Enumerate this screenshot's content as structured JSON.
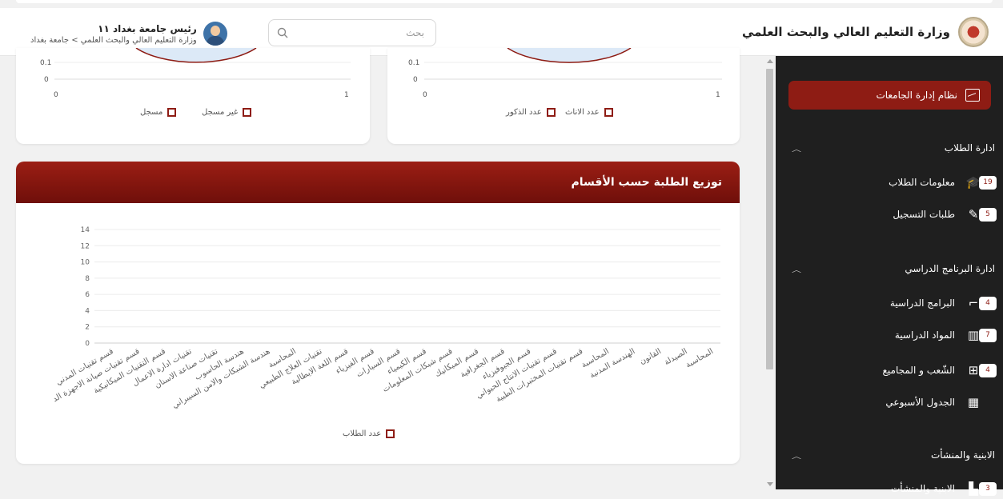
{
  "header": {
    "brand_title": "وزارة التعليم العالي والبحث العلمي",
    "search_placeholder": "بحث",
    "user_name": "رئيس جامعة بغداد ١١",
    "user_breadcrumb": "وزارة التعليم العالي والبحث العلمي > جامعة بغداد"
  },
  "sidebar": {
    "active_item": "نظام إدارة الجامعات",
    "sections": [
      {
        "title": "ادارة الطلاب",
        "items": [
          {
            "label": "معلومات الطلاب",
            "badge": "19",
            "icon": "graduate-icon"
          },
          {
            "label": "طلبات التسجيل",
            "badge": "5",
            "icon": "edit-icon"
          }
        ]
      },
      {
        "title": "ادارة البرنامج الدراسي",
        "items": [
          {
            "label": "البرامج الدراسية",
            "badge": "4",
            "icon": "presentation-icon"
          },
          {
            "label": "المواد الدراسية",
            "badge": "7",
            "icon": "books-icon"
          },
          {
            "label": "الشّعب و المجاميع",
            "badge": "4",
            "icon": "hierarchy-icon"
          },
          {
            "label": "الجدول الأسبوعي",
            "badge": "",
            "icon": "calendar-icon"
          }
        ]
      },
      {
        "title": "الابنية والمنشأت",
        "items": [
          {
            "label": "الابنية والمنشأت",
            "badge": "3",
            "icon": "building-icon"
          }
        ]
      }
    ]
  },
  "top_left_chart": {
    "y_ticks": [
      "0.1",
      "0"
    ],
    "x_ticks": [
      "0",
      "1"
    ],
    "legend": [
      "غير مسجل",
      "مسجل"
    ]
  },
  "top_right_chart": {
    "y_ticks": [
      "0.1",
      "0"
    ],
    "x_ticks": [
      "0",
      "1"
    ],
    "legend": [
      "عدد الاناث",
      "عدد الذكور"
    ]
  },
  "dept_card": {
    "title": "توزيع الطلبة حسب الأقسام",
    "legend": "عدد الطلاب"
  },
  "colors": {
    "accent": "#8e1c14",
    "sidebar": "#1f1f1f"
  },
  "chart_data": {
    "type": "bar",
    "title": "توزيع الطلبة حسب الأقسام",
    "ylim": [
      0,
      14
    ],
    "y_ticks": [
      0,
      2,
      4,
      6,
      8,
      10,
      12,
      14
    ],
    "categories": [
      "قسم تقنيات المدني",
      "قسم تقنيات صيانة الاجهزة الد",
      "قسم التقنيات الميكانيكية",
      "تقنيات ادارة الاعمال",
      "تقنيات صناعة الاسنان",
      "هندسة الحاسوب",
      "هندسة الشبكات والامن السيبراني",
      "المحاسبة",
      "تقنيات العلاج الطبيعي",
      "قسم اللغة الايطالية",
      "قسم الفيزياء",
      "قسم السيارات",
      "قسم الكيمياء",
      "قسم شبكات المعلومات",
      "قسم الميكانيك",
      "قسم الجغرافية",
      "قسم الجيوفيزياء",
      "قسم تقنيات الانتاج الحيواني",
      "قسم تقنيات المختبرات الطبية",
      "المحاسبة",
      "الهندسة المدنية",
      "القانون",
      "الصيدلة",
      "المحاسبة"
    ],
    "series": [
      {
        "name": "عدد الطلاب",
        "values": [
          0,
          0,
          0,
          0,
          0,
          0,
          0,
          0,
          0,
          0,
          0,
          0,
          0,
          0,
          0,
          0,
          0,
          0,
          0,
          0,
          0,
          0,
          0,
          0
        ]
      }
    ]
  }
}
